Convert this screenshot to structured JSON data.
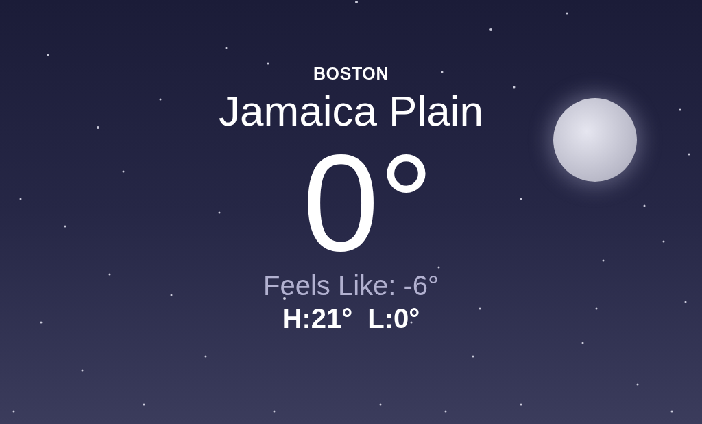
{
  "location": {
    "city": "BOSTON",
    "name": "Jamaica Plain"
  },
  "temperature": "0°",
  "feels_like": "Feels Like: -6°",
  "high": "H:21°",
  "low": "L:0°"
}
